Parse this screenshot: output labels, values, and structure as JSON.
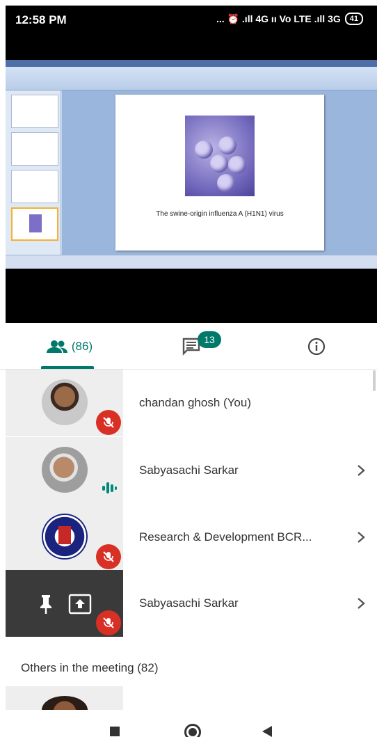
{
  "status_bar": {
    "time": "12:58 PM",
    "indicators": "... ⏰ .ıll 4G ıı Vo LTE .ıll 3G",
    "battery": "41"
  },
  "shared_screen": {
    "slide_caption": "The swine-origin influenza A (H1N1) virus"
  },
  "tabs": {
    "people_count": "(86)",
    "chat_badge": "13",
    "people_icon": "people-icon",
    "chat_icon": "chat-icon",
    "info_icon": "info-icon"
  },
  "participants": [
    {
      "name": "chandan ghosh (You)",
      "mic": "muted"
    },
    {
      "name": "Sabyasachi Sarkar",
      "mic": "speaking"
    },
    {
      "name": "Research & Development BCR...",
      "mic": "muted"
    },
    {
      "name": "Sabyasachi Sarkar",
      "mic": "muted",
      "presenting": true
    }
  ],
  "others_section": {
    "label": "Others in the meeting (82)"
  },
  "colors": {
    "accent": "#00796b",
    "mute_red": "#d93025"
  }
}
